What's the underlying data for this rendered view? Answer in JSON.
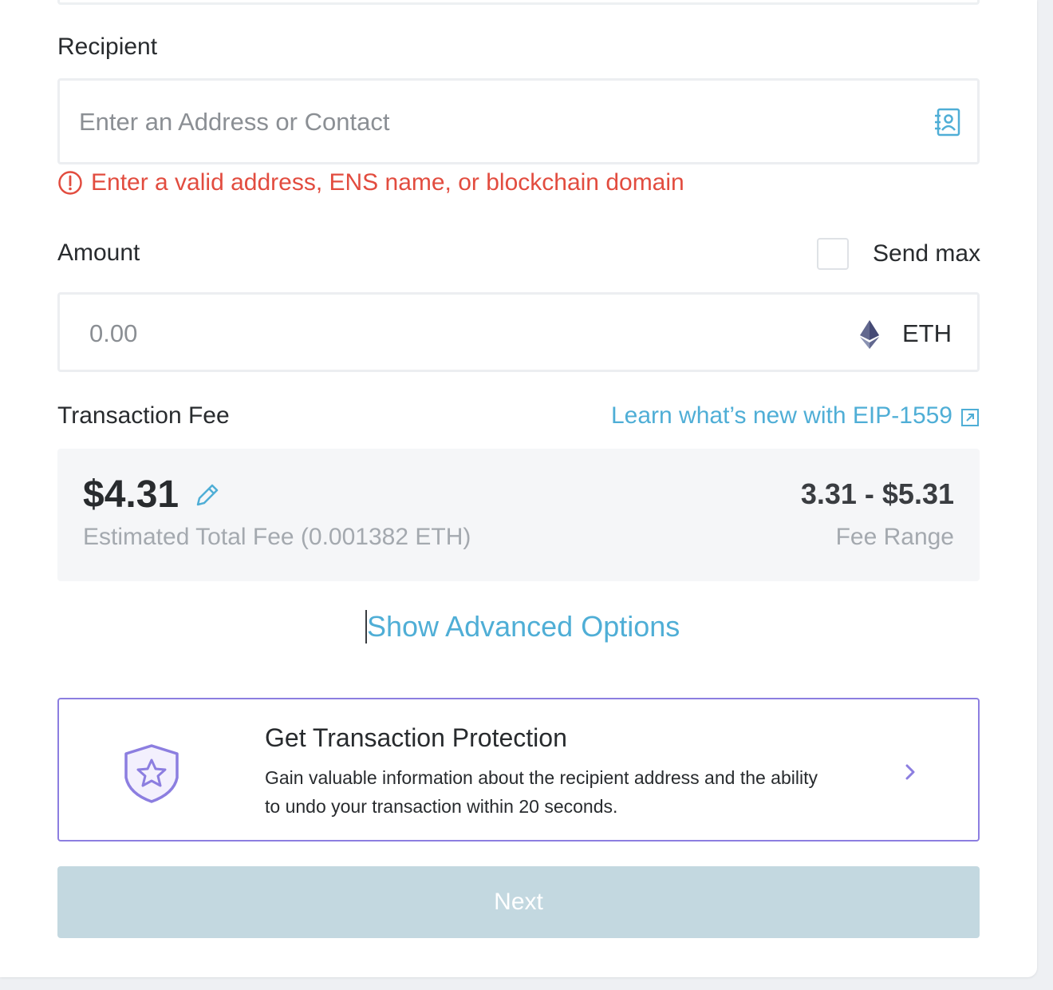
{
  "recipient": {
    "label": "Recipient",
    "placeholder": "Enter an Address or Contact",
    "contact_icon": "address-book-icon",
    "error": "Enter a valid address, ENS name, or blockchain domain"
  },
  "amount": {
    "label": "Amount",
    "send_max_label": "Send max",
    "send_max_checked": false,
    "placeholder": "0.00",
    "currency": "ETH",
    "currency_icon": "ethereum-icon"
  },
  "fee": {
    "label": "Transaction Fee",
    "learn_link": "Learn what’s new with EIP-1559",
    "estimated_value": "$4.31",
    "estimated_caption": "Estimated Total Fee (0.001382 ETH)",
    "range_value": "3.31 - $5.31",
    "range_caption": "Fee Range"
  },
  "advanced": {
    "label": "Show Advanced Options"
  },
  "protection": {
    "title": "Get Transaction Protection",
    "description": "Gain valuable information about the recipient address and the ability to undo your transaction within 20 seconds.",
    "icon": "shield-star-icon"
  },
  "next_button": {
    "label": "Next"
  },
  "colors": {
    "link": "#4faed6",
    "error": "#e24c3f",
    "protection_accent": "#8c7ee0",
    "next_disabled": "#c3d8e0"
  }
}
